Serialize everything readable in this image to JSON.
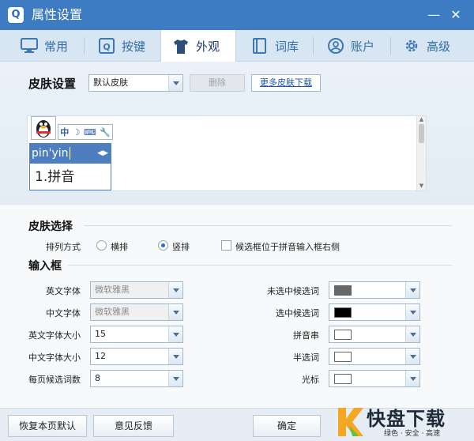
{
  "window": {
    "app_icon_letter": "Q",
    "title": "属性设置",
    "minimize": "—",
    "close": "✕"
  },
  "tabs": [
    {
      "label": "常用",
      "icon": "monitor-icon"
    },
    {
      "label": "按键",
      "icon": "q-key-icon"
    },
    {
      "label": "外观",
      "icon": "shirt-icon",
      "active": true
    },
    {
      "label": "词库",
      "icon": "book-icon"
    },
    {
      "label": "账户",
      "icon": "user-icon"
    },
    {
      "label": "高级",
      "icon": "gear-icon"
    }
  ],
  "skin": {
    "label": "皮肤设置",
    "selected": "默认皮肤",
    "delete_label": "删除",
    "more_link": "更多皮肤下载"
  },
  "preview": {
    "toolbar_glyphs": [
      "中",
      "☽",
      "⌨",
      "🔧"
    ],
    "input_text": "pin'yin",
    "candidate": "1.拼音"
  },
  "skin_select": {
    "heading": "皮肤选择",
    "layout_label": "排列方式",
    "options": [
      "横排",
      "竖排"
    ],
    "selected_option": "竖排",
    "checkbox_label": "候选框位于拼音输入框右侧"
  },
  "input_box": {
    "heading": "输入框",
    "left_fields": [
      {
        "label": "英文字体",
        "value": "微软雅黑",
        "disabled": true
      },
      {
        "label": "中文字体",
        "value": "微软雅黑",
        "disabled": true
      },
      {
        "label": "英文字体大小",
        "value": "15"
      },
      {
        "label": "中文字体大小",
        "value": "12"
      },
      {
        "label": "每页候选词数",
        "value": "8"
      }
    ],
    "right_fields": [
      {
        "label": "未选中候选词",
        "color": "#666666"
      },
      {
        "label": "选中候选词",
        "color": "#000000"
      },
      {
        "label": "拼音串",
        "color": "#ffffff"
      },
      {
        "label": "半选词",
        "color": "#ffffff"
      },
      {
        "label": "光标",
        "color": "#ffffff"
      }
    ]
  },
  "footer": {
    "restore": "恢复本页默认",
    "feedback": "意见反馈",
    "ok": "确定"
  },
  "watermark": {
    "main": "快盘下载",
    "sub": "绿色 · 安全 · 高速"
  },
  "colors": {
    "titlebar": "#3d7cc2",
    "tabbar": "#d8e6f3",
    "accent": "#2a6fd0"
  }
}
